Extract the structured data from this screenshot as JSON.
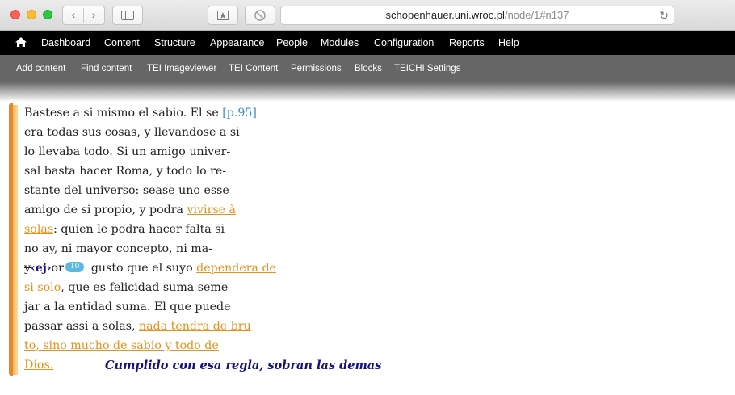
{
  "browser": {
    "url_host": "schopenhauer.uni.wroc.pl",
    "url_path": "/node/1#n137",
    "icons": [
      "back-icon",
      "forward-icon",
      "sidebar-icon",
      "share-icon",
      "stop-icon",
      "reload-icon"
    ]
  },
  "toolbar": {
    "home_icon": "home-icon",
    "items": [
      "Dashboard",
      "Content",
      "Structure",
      "Appearance",
      "People",
      "Modules",
      "Configuration",
      "Reports",
      "Help"
    ]
  },
  "secondary": {
    "items": [
      "Add content",
      "Find content",
      "TEI Imageviewer",
      "TEI Content",
      "Permissions",
      "Blocks",
      "TEICHI Settings"
    ]
  },
  "text": {
    "l1a": "Bastese a si mismo el sabio. El se ",
    "pb": "[p.95]",
    "l2": "era todas sus cosas, y llevandose a si",
    "l3": "lo llevaba todo. Si un amigo univer-",
    "l4": "sal basta hacer Roma, y todo lo re-",
    "l5": "stante del universo: sease uno esse",
    "l6a": "amigo de si propio, y podra ",
    "l6u": "vivirse à",
    "l7u": "solas",
    "l7b": ": quien le podra hacer falta si",
    "l8": "no ay, ni mayor concepto, ni ma-",
    "l9del": "y",
    "l9ej": "‹ej›",
    "l9or": "or",
    "note_num": "10",
    "l9b": " gusto que el suyo ",
    "l9u": "dependera de",
    "l10u": "si solo",
    "l10b": ", que es felicidad suma seme-",
    "l11": "jar a la entidad suma. El que puede",
    "l12a": "passar assi a solas, ",
    "l12u": "nada tendra de bru",
    "l13u": "to, sino mucho de sabio y todo de ",
    "l14u": "Dios. ",
    "margin_note": "Cumplido con esa regla, sobran las demas"
  },
  "colors": {
    "highlight": "#e8901b",
    "pagebreak": "#3b8fc4",
    "note_badge": "#5bb9e0",
    "margin_note": "#141380",
    "ej": "#1a1777"
  }
}
